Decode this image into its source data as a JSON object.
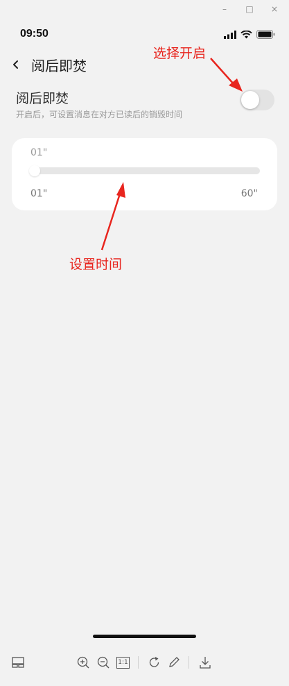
{
  "window_controls": [
    "–",
    "□",
    "×"
  ],
  "status_bar": {
    "time": "09:50"
  },
  "nav": {
    "title": "阅后即焚"
  },
  "setting": {
    "title": "阅后即焚",
    "description": "开启后，可设置消息在对方已读后的销毁时间",
    "toggle_on": false
  },
  "slider": {
    "current": "01\"",
    "min_label": "01\"",
    "max_label": "60\"",
    "value_fraction": 0
  },
  "annotations": {
    "enable": "选择开启",
    "set_time": "设置时间",
    "color": "#e8251e"
  },
  "toolbar": {
    "icons": [
      "layout-icon",
      "zoom-in-icon",
      "zoom-out-icon",
      "actual-size-icon",
      "rotate-icon",
      "edit-icon",
      "download-icon"
    ],
    "actual_size_label": "1:1"
  }
}
